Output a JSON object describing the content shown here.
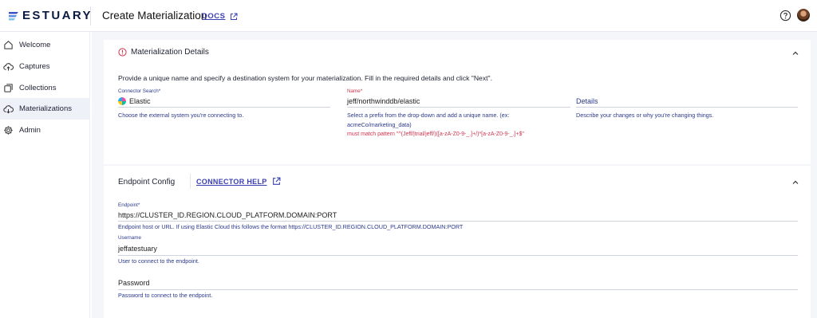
{
  "header": {
    "brand": "ESTUARY",
    "title": "Create Materialization",
    "docs_label": "DOCS"
  },
  "sidebar": {
    "items": [
      {
        "label": "Welcome",
        "icon": "home-icon"
      },
      {
        "label": "Captures",
        "icon": "cloud-upload-icon"
      },
      {
        "label": "Collections",
        "icon": "collections-icon"
      },
      {
        "label": "Materializations",
        "icon": "cloud-download-icon",
        "active": true
      },
      {
        "label": "Admin",
        "icon": "gear-icon"
      }
    ]
  },
  "details": {
    "title": "Materialization Details",
    "description": "Provide a unique name and specify a destination system for your materialization. Fill in the required details and click \"Next\".",
    "connector": {
      "label": "Connector Search*",
      "value": "Elastic",
      "help": "Choose the external system you're connecting to."
    },
    "name": {
      "label": "Name*",
      "value": "jeff/northwinddb/elastic",
      "help": "Select a prefix from the drop-down and add a unique name. (ex: acmeCo/marketing_data)",
      "error": "must match pattern \"^(Jeff/|trial/jeff/)([a-zA-Z0-9-_.]+/)*[a-zA-Z0-9-_.]+$\""
    },
    "details_field": {
      "placeholder": "Details",
      "help": "Describe your changes or why you're changing things."
    }
  },
  "endpoint": {
    "title": "Endpoint Config",
    "connector_help": "CONNECTOR HELP",
    "fields": [
      {
        "label": "Endpoint*",
        "value": "https://CLUSTER_ID.REGION.CLOUD_PLATFORM.DOMAIN:PORT",
        "help": "Endpoint host or URL. If using Elastic Cloud this follows the format https://CLUSTER_ID.REGION.CLOUD_PLATFORM.DOMAIN:PORT"
      },
      {
        "label": "Username",
        "value": "jeffatestuary",
        "help": "User to connect to the endpoint."
      },
      {
        "label": "",
        "value": "Password",
        "help": "Password to connect to the endpoint."
      }
    ]
  },
  "colors": {
    "accent": "#3a3fb0",
    "error": "#d0344e",
    "brand": "#0a1a40"
  }
}
